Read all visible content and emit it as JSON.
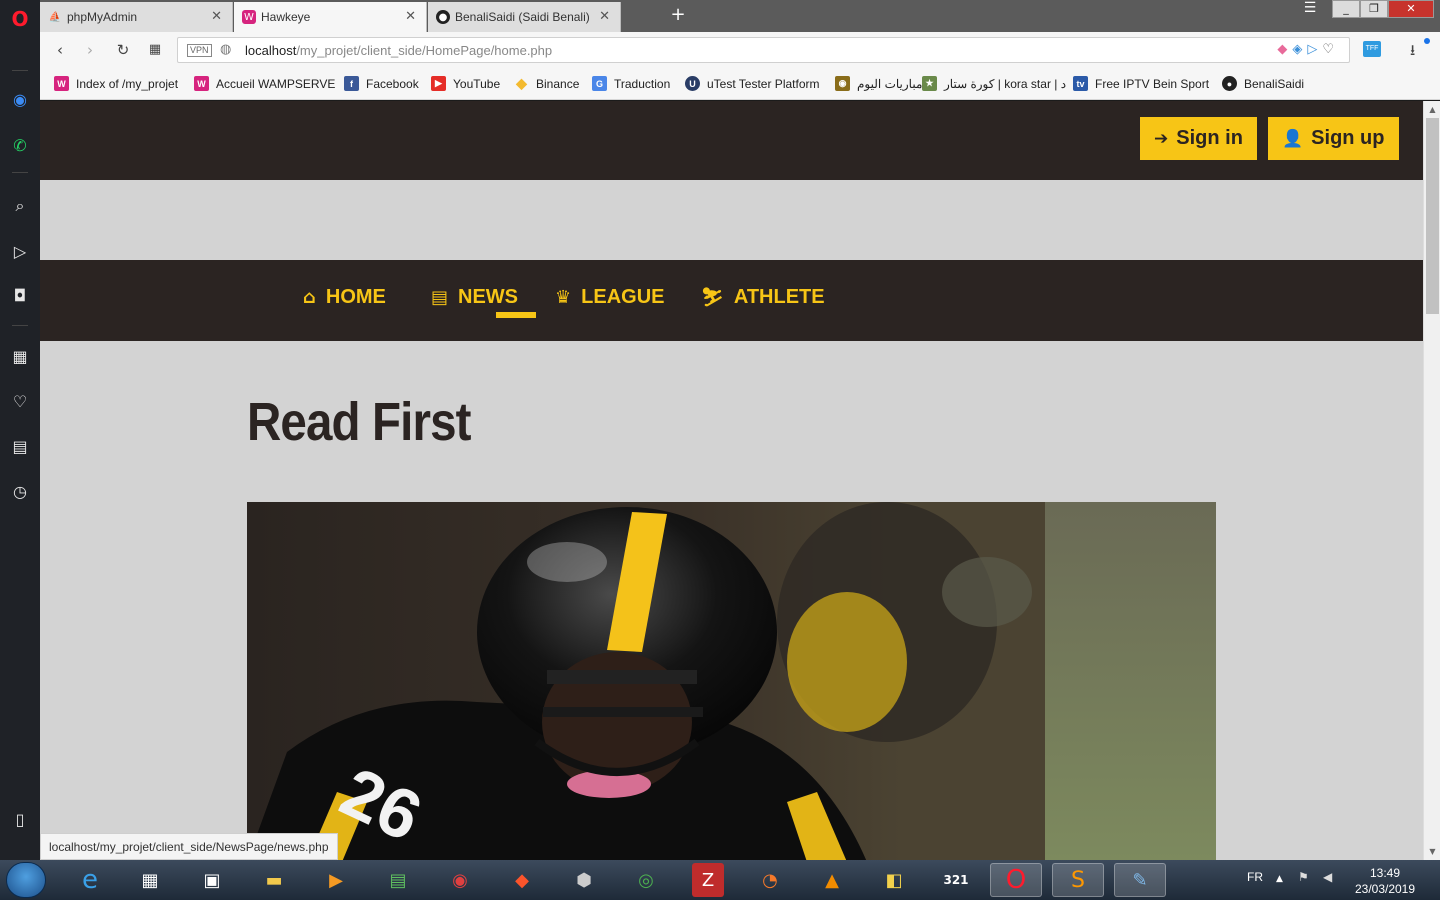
{
  "browser": {
    "tabs": [
      {
        "label": "phpMyAdmin",
        "icon": "phpmyadmin-icon",
        "active": false
      },
      {
        "label": "Hawkeye",
        "icon": "wamp-icon",
        "active": true
      },
      {
        "label": "BenaliSaidi (Saidi Benali)",
        "icon": "github-icon",
        "active": false
      }
    ],
    "new_tab": "+",
    "vpn_label": "VPN",
    "url_host": "localhost",
    "url_path": "/my_projet/client_side/HomePage/home.php",
    "ext_label": "TFF",
    "bookmarks": [
      {
        "label": "Index of /my_projet",
        "color": "#d6247e"
      },
      {
        "label": "Accueil WAMPSERVE",
        "color": "#d6247e"
      },
      {
        "label": "Facebook",
        "color": "#3b5998"
      },
      {
        "label": "YouTube",
        "color": "#e52d27"
      },
      {
        "label": "Binance",
        "color": "#f3ba2f"
      },
      {
        "label": "Traduction",
        "color": "#4a86e8"
      },
      {
        "label": "uTest Tester Platform",
        "color": "#2a3d66"
      },
      {
        "label": "مباريات اليوم",
        "color": "#8a6d1a"
      },
      {
        "label": "كورة ستار | kora star | د",
        "color": "#6a8a4a"
      },
      {
        "label": "Free IPTV Bein Sport",
        "color": "#2b5aa8"
      },
      {
        "label": "BenaliSaidi",
        "color": "#222222"
      }
    ],
    "status_url": "localhost/my_projet/client_side/NewsPage/news.php"
  },
  "site": {
    "auth": {
      "signin_label": "Sign in",
      "signup_label": "Sign up"
    },
    "nav": [
      {
        "label": "HOME",
        "icon": "home-icon",
        "glyph": "⌂"
      },
      {
        "label": "NEWS",
        "icon": "newspaper-icon",
        "glyph": "▤"
      },
      {
        "label": "LEAGUE",
        "icon": "trophy-icon",
        "glyph": "🏆"
      },
      {
        "label": "ATHLETE",
        "icon": "skiing-icon",
        "glyph": "⛷"
      }
    ],
    "active_nav": "NEWS",
    "heading": "Read First",
    "colors": {
      "accent": "#f7c516",
      "dark": "#2b2422",
      "page_bg": "#d3d3d3"
    }
  },
  "taskbar": {
    "lang": "FR",
    "time": "13:49",
    "date": "23/03/2019"
  }
}
